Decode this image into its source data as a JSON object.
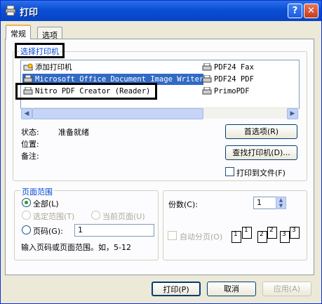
{
  "window": {
    "title": "打印",
    "help_label": "?",
    "close_label": "✕"
  },
  "tabs": [
    {
      "label": "常规"
    },
    {
      "label": "选项"
    }
  ],
  "select_printer": {
    "legend": "选择打印机",
    "printers": [
      {
        "name": "添加打印机",
        "icon": "add-printer-icon",
        "selected": false
      },
      {
        "name": "Microsoft Office Document Image Writer",
        "icon": "printer-icon",
        "selected": true
      },
      {
        "name": "Nitro PDF Creator (Reader)",
        "icon": "printer-icon",
        "selected": false
      },
      {
        "name": "PDF24 Fax",
        "icon": "printer-icon",
        "selected": false
      },
      {
        "name": "PDF24 PDF",
        "icon": "printer-icon",
        "selected": false
      },
      {
        "name": "PrimoPDF",
        "icon": "printer-icon",
        "selected": false
      }
    ],
    "scroll_left": "◀",
    "scroll_right": "▶"
  },
  "status": {
    "status_label": "状态:",
    "status_value": "准备就绪",
    "location_label": "位置:",
    "comment_label": "备注:",
    "preferences_button": "首选项(R)",
    "find_printer_button": "查找打印机(D)...",
    "print_to_file_label": "打印到文件(F)"
  },
  "page_range": {
    "legend": "页面范围",
    "all_label": "全部(L)",
    "selection_label": "选定范围(T)",
    "current_page_label": "当前页面(U)",
    "pages_label": "页码(G):",
    "pages_value": "1",
    "hint": "输入页码或页面范围。如，5-12"
  },
  "copies": {
    "label": "份数(C):",
    "value": "1",
    "spin_up": "▲",
    "spin_down": "▼",
    "collate_label": "自动分页(O)",
    "collate_pages": [
      "1",
      "1",
      "2",
      "2",
      "3",
      "3"
    ]
  },
  "footer": {
    "print_button": "打印(P)",
    "cancel_button": "取消",
    "apply_button": "应用(A)"
  }
}
